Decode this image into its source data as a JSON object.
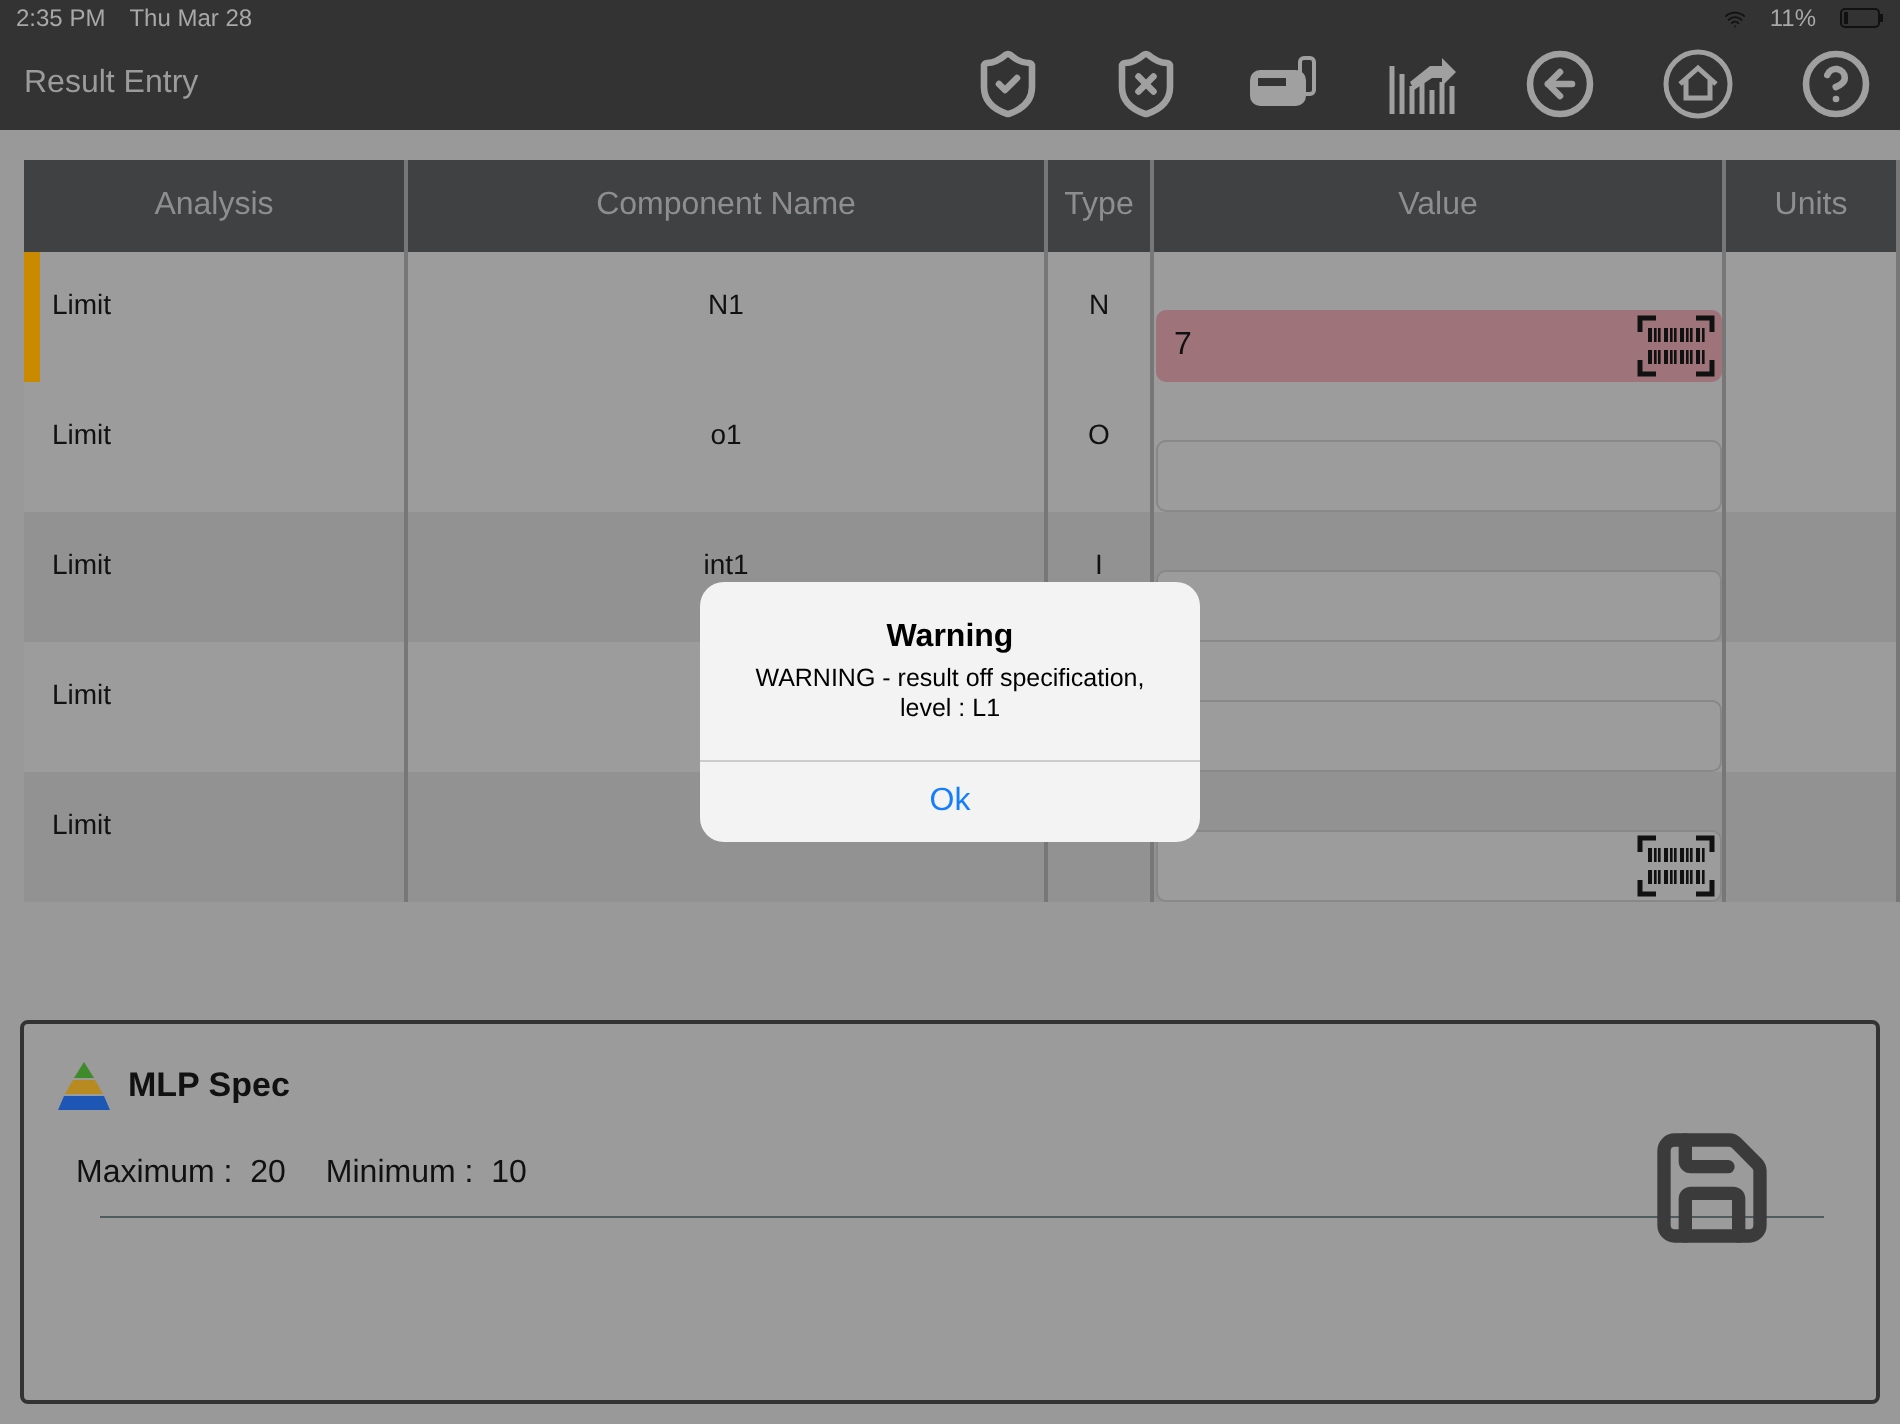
{
  "status_bar": {
    "time": "2:35 PM",
    "date": "Thu Mar 28",
    "battery": "11%"
  },
  "header": {
    "title": "Result Entry"
  },
  "table": {
    "columns": [
      "Analysis",
      "Component Name",
      "Type",
      "Value",
      "Units"
    ],
    "rows": [
      {
        "analysis": "Limit",
        "component": "N1",
        "type": "N",
        "value": "7",
        "flagged": true,
        "scanner": true
      },
      {
        "analysis": "Limit",
        "component": "o1",
        "type": "O",
        "value": "",
        "flagged": false,
        "scanner": false
      },
      {
        "analysis": "Limit",
        "component": "int1",
        "type": "I",
        "value": "",
        "flagged": false,
        "scanner": false
      },
      {
        "analysis": "Limit",
        "flagged": false,
        "scanner": false
      },
      {
        "analysis": "Limit",
        "flagged": false,
        "scanner": true
      }
    ]
  },
  "spec_panel": {
    "title": "MLP Spec",
    "fields": [
      {
        "label": "Maximum :",
        "value": "20"
      },
      {
        "label": "Minimum :",
        "value": "10"
      }
    ]
  },
  "dialog": {
    "title": "Warning",
    "message": "WARNING - result off specification, level : L1",
    "button": "Ok"
  }
}
